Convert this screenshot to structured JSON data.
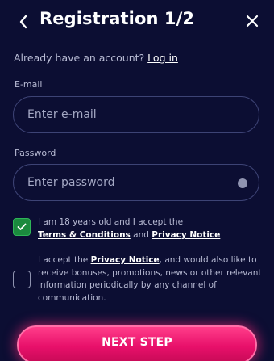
{
  "header": {
    "title": "Registration 1/2",
    "back_icon": "chevron-left-icon",
    "close_icon": "close-icon"
  },
  "login": {
    "prompt": "Already have an account?",
    "link": "Log in"
  },
  "email": {
    "label": "E-mail",
    "placeholder": "Enter e-mail",
    "value": ""
  },
  "password": {
    "label": "Password",
    "placeholder": "Enter password",
    "value": "",
    "toggle_icon": "eye-icon"
  },
  "terms_consent": {
    "checked": true,
    "text_before": "I am 18 years old and I accept the",
    "terms_link": "Terms & Conditions",
    "joiner": "and",
    "privacy_link": "Privacy Notice"
  },
  "marketing_consent": {
    "checked": false,
    "text_before": "I accept the",
    "privacy_link": "Privacy Notice",
    "text_after": ", and would also like to receive bonuses, promotions, news or other relevant information periodically by any channel of communication."
  },
  "next_button": {
    "label": "NEXT STEP"
  },
  "colors": {
    "background": "#0c0e33",
    "accent": "#e8106a",
    "checkbox_checked": "#1b8a3e",
    "field_border": "#3d4375"
  }
}
